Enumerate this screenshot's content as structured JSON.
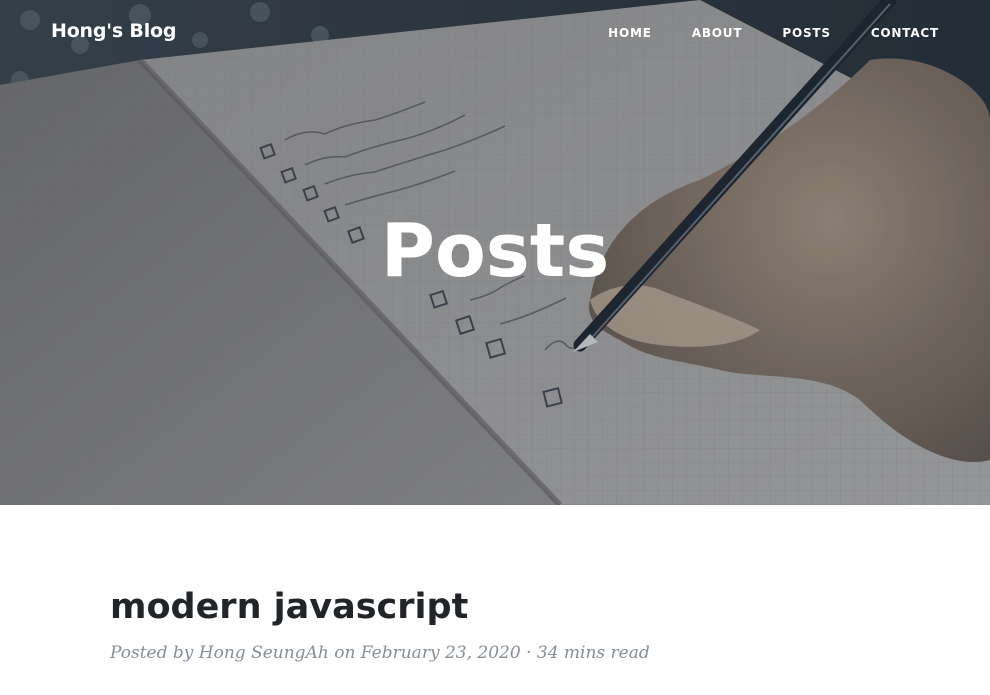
{
  "navbar": {
    "brand": "Hong's Blog",
    "links": [
      {
        "label": "HOME"
      },
      {
        "label": "ABOUT"
      },
      {
        "label": "POSTS"
      },
      {
        "label": "CONTACT"
      }
    ]
  },
  "hero": {
    "heading": "Posts",
    "image_subject": "notebook-checklist-with-pen"
  },
  "post": {
    "title": "modern javascript",
    "meta_prefix": "Posted by",
    "author": "Hong SeungAh",
    "meta_on": "on",
    "date": "February 23, 2020",
    "separator": "·",
    "read_time": "34 mins read"
  },
  "colors": {
    "hero_text": "#ffffff",
    "title": "#212529",
    "meta": "#868e96"
  }
}
